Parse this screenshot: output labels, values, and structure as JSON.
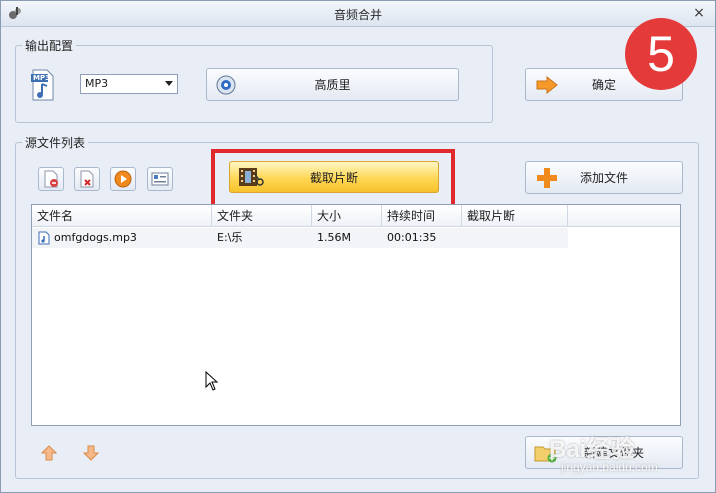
{
  "window": {
    "title": "音频合并",
    "close_glyph": "×"
  },
  "output_group": {
    "label": "输出配置",
    "format_icon_text": "MP3",
    "format_select": "MP3",
    "quality_button": "高质里",
    "confirm_button": "确定"
  },
  "step_badge": "5",
  "source_group": {
    "label": "源文件列表",
    "clip_button": "截取片断",
    "add_button": "添加文件",
    "new_folder_button": "新建文件夹",
    "columns": [
      "文件名",
      "文件夹",
      "大小",
      "持续时间",
      "截取片断"
    ],
    "rows": [
      {
        "name": "omfgdogs.mp3",
        "folder": "E:\\乐",
        "size": "1.56M",
        "duration": "00:01:35",
        "clip": ""
      }
    ]
  },
  "watermark": {
    "main": "Bai经验",
    "sub": "jingyan.baidu.com"
  },
  "colors": {
    "accent_red": "#e0292d",
    "badge": "#e53a3a",
    "highlight": "#ffd755"
  }
}
